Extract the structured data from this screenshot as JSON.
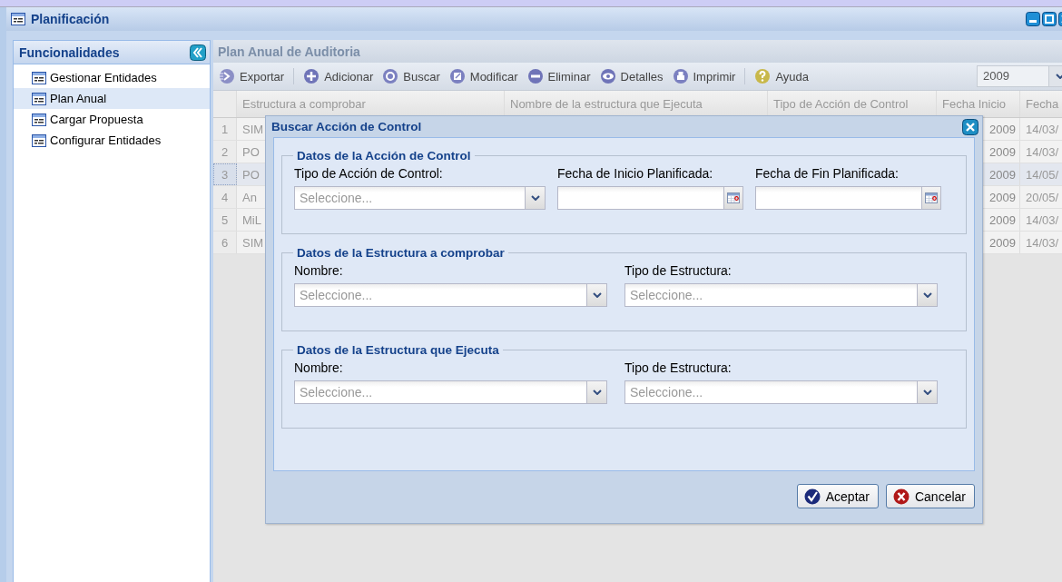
{
  "window": {
    "title": "Planificación"
  },
  "sidebar": {
    "title": "Funcionalidades",
    "items": [
      {
        "label": "Gestionar Entidades",
        "selected": false
      },
      {
        "label": "Plan Anual",
        "selected": true
      },
      {
        "label": "Cargar Propuesta",
        "selected": false
      },
      {
        "label": "Configurar Entidades",
        "selected": false
      }
    ]
  },
  "main": {
    "title": "Plan Anual de Auditoria",
    "toolbar": [
      {
        "label": "Exportar",
        "kind": "export"
      },
      {
        "label": "Adicionar",
        "kind": "add"
      },
      {
        "label": "Buscar",
        "kind": "search"
      },
      {
        "label": "Modificar",
        "kind": "edit"
      },
      {
        "label": "Eliminar",
        "kind": "delete"
      },
      {
        "label": "Detalles",
        "kind": "details"
      },
      {
        "label": "Imprimir",
        "kind": "print"
      },
      {
        "label": "Ayuda",
        "kind": "help"
      }
    ],
    "year": "2009",
    "table": {
      "columns": [
        "Estructura a comprobar",
        "Nombre de la estructura que Ejecuta",
        "Tipo de Acción de Control",
        "Fecha Inicio",
        "Fecha"
      ],
      "rows": [
        {
          "number": "1",
          "column_1": "SIM",
          "fecha_inicio": "2009",
          "fecha": "14/03/",
          "selected": false
        },
        {
          "number": "2",
          "column_1": "PO",
          "fecha_inicio": "2009",
          "fecha": "14/03/",
          "selected": false
        },
        {
          "number": "3",
          "column_1": "PO",
          "fecha_inicio": "2009",
          "fecha": "14/05/",
          "selected": true
        },
        {
          "number": "4",
          "column_1": "An",
          "fecha_inicio": "2009",
          "fecha": "20/05/",
          "selected": false
        },
        {
          "number": "5",
          "column_1": "MiL",
          "fecha_inicio": "2009",
          "fecha": "14/03/",
          "selected": false
        },
        {
          "number": "6",
          "column_1": "SIM",
          "fecha_inicio": "2009",
          "fecha": "14/03/",
          "selected": false
        }
      ]
    }
  },
  "dialog": {
    "title": "Buscar Acción de Control",
    "sections": [
      {
        "title": "Datos de la Acción de Control",
        "fields": [
          {
            "label": "Tipo de Acción de Control:",
            "kind": "combo",
            "placeholder": "Seleccione..."
          },
          {
            "label": "Fecha de Inicio Planificada:",
            "kind": "date"
          },
          {
            "label": "Fecha de Fin Planificada:",
            "kind": "date"
          }
        ]
      },
      {
        "title": "Datos de la Estructura a comprobar",
        "fields": [
          {
            "label": "Nombre:",
            "kind": "combo",
            "placeholder": "Seleccione..."
          },
          {
            "label": "Tipo de Estructura:",
            "kind": "combo",
            "placeholder": "Seleccione..."
          }
        ]
      },
      {
        "title": "Datos de la Estructura que Ejecuta",
        "fields": [
          {
            "label": "Nombre:",
            "kind": "combo",
            "placeholder": "Seleccione..."
          },
          {
            "label": "Tipo de Estructura:",
            "kind": "combo",
            "placeholder": "Seleccione..."
          }
        ]
      }
    ],
    "buttons": [
      {
        "label": "Aceptar",
        "kind": "accept"
      },
      {
        "label": "Cancelar",
        "kind": "cancel"
      }
    ]
  }
}
